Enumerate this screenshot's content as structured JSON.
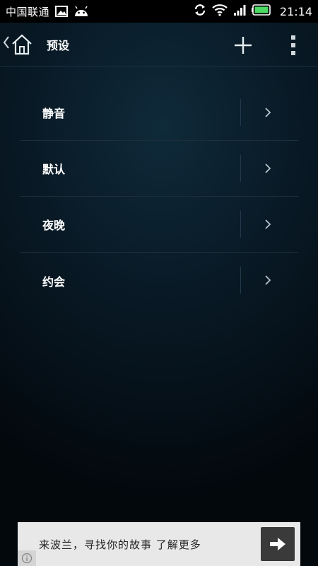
{
  "status_bar": {
    "carrier": "中国联通",
    "time": "21:14",
    "icons": [
      "image-icon",
      "android-icon",
      "sync-icon",
      "wifi-icon",
      "signal-icon",
      "battery-icon"
    ]
  },
  "action_bar": {
    "title": "预设",
    "icons": [
      "back-chevron-icon",
      "home-icon",
      "plus-icon",
      "more-vert-icon"
    ]
  },
  "presets": {
    "items": [
      {
        "label": "静音"
      },
      {
        "label": "默认"
      },
      {
        "label": "夜晚"
      },
      {
        "label": "约会"
      }
    ]
  },
  "ad": {
    "text": "来波兰，寻找你的故事 了解更多"
  },
  "colors": {
    "battery": "#4cd964",
    "ad_background": "#e8e8e8"
  }
}
